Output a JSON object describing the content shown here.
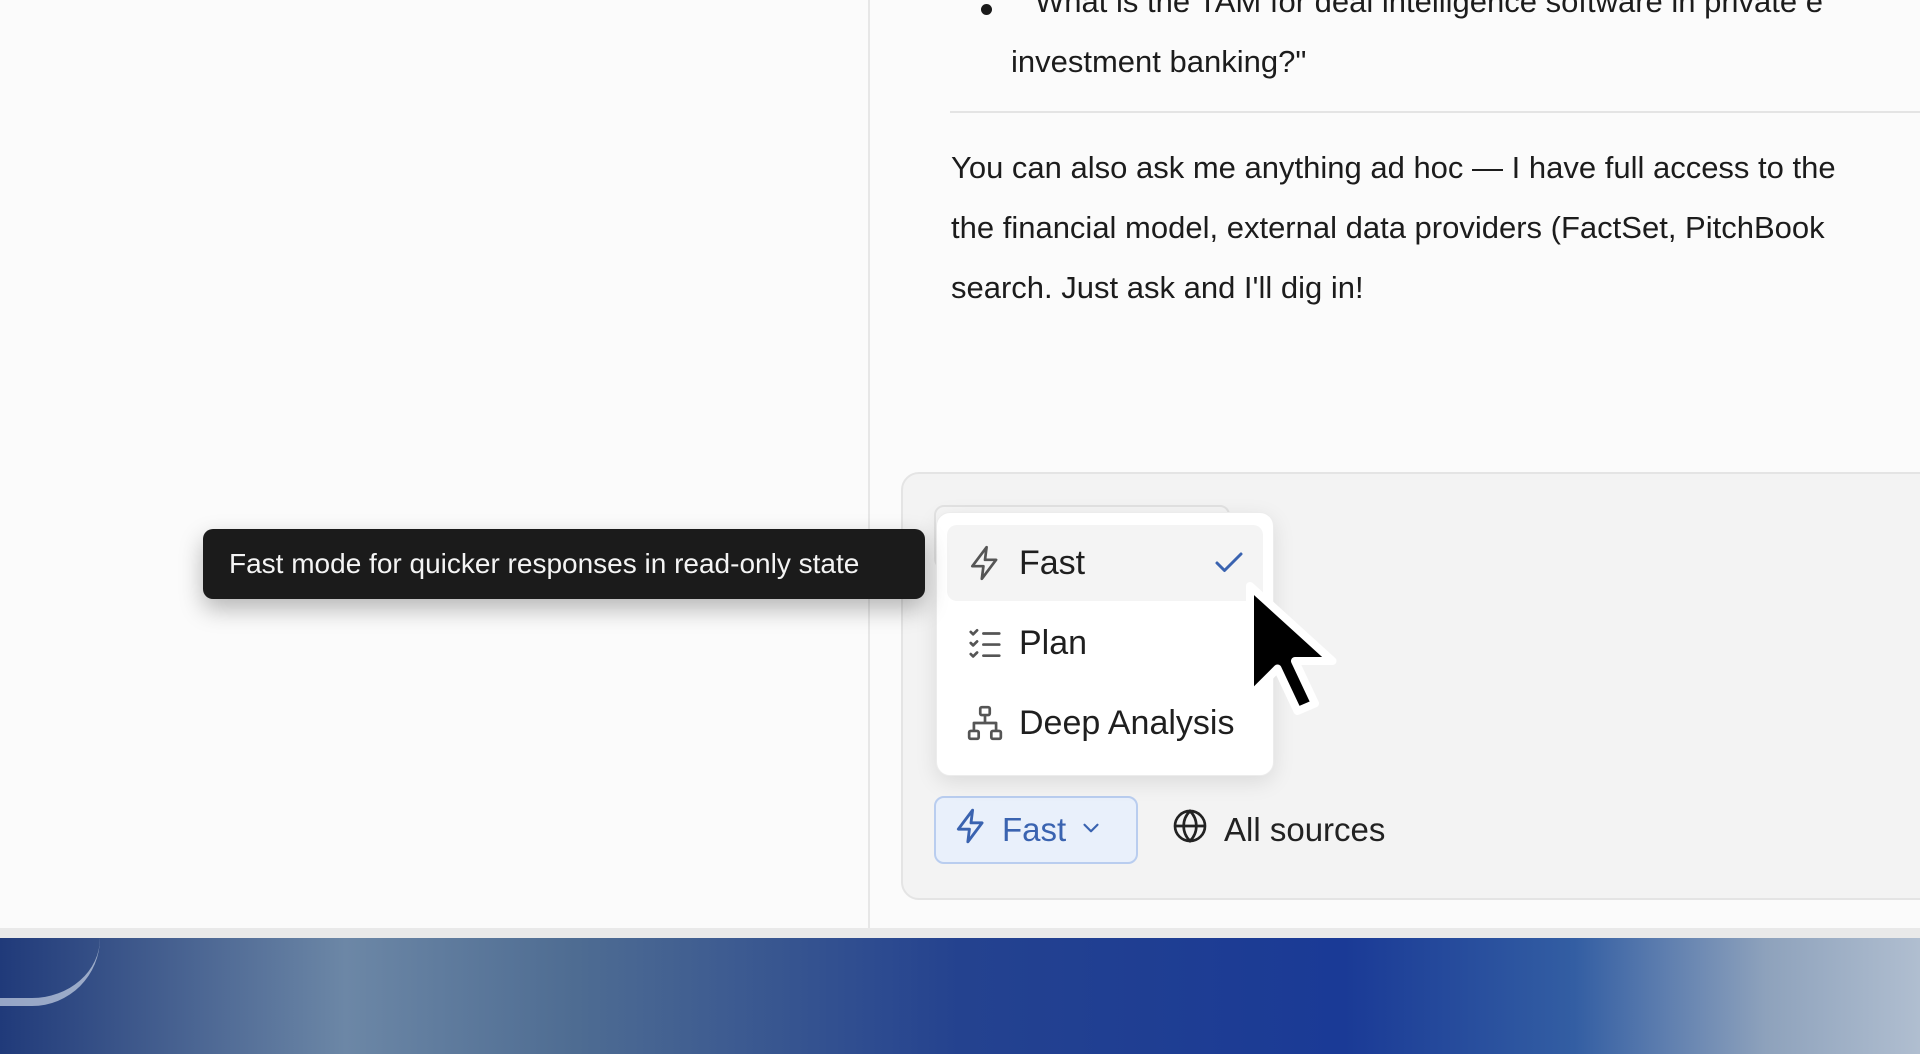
{
  "chat": {
    "bullet_line1": "\"What is the TAM for deal intelligence software in private e",
    "bullet_line2": "investment banking?\"",
    "paragraph": [
      "You can also ask me anything ad hoc — I have full access to the",
      "the financial model, external data providers (FactSet, PitchBook",
      "search. Just ask and I'll dig in!"
    ]
  },
  "tooltip": {
    "text": "Fast mode for quicker responses in read-only state"
  },
  "mode_menu": {
    "items": [
      {
        "label": "Fast",
        "icon": "lightning-icon",
        "selected": true
      },
      {
        "label": "Plan",
        "icon": "checklist-icon",
        "selected": false
      },
      {
        "label": "Deep Analysis",
        "icon": "hierarchy-icon",
        "selected": false
      }
    ]
  },
  "composer": {
    "mode_button_label": "Fast",
    "sources_label": "All sources"
  },
  "colors": {
    "accent": "#3a63b0",
    "accent_bg": "#e9f0fb",
    "tooltip_bg": "#1b1b1b"
  }
}
